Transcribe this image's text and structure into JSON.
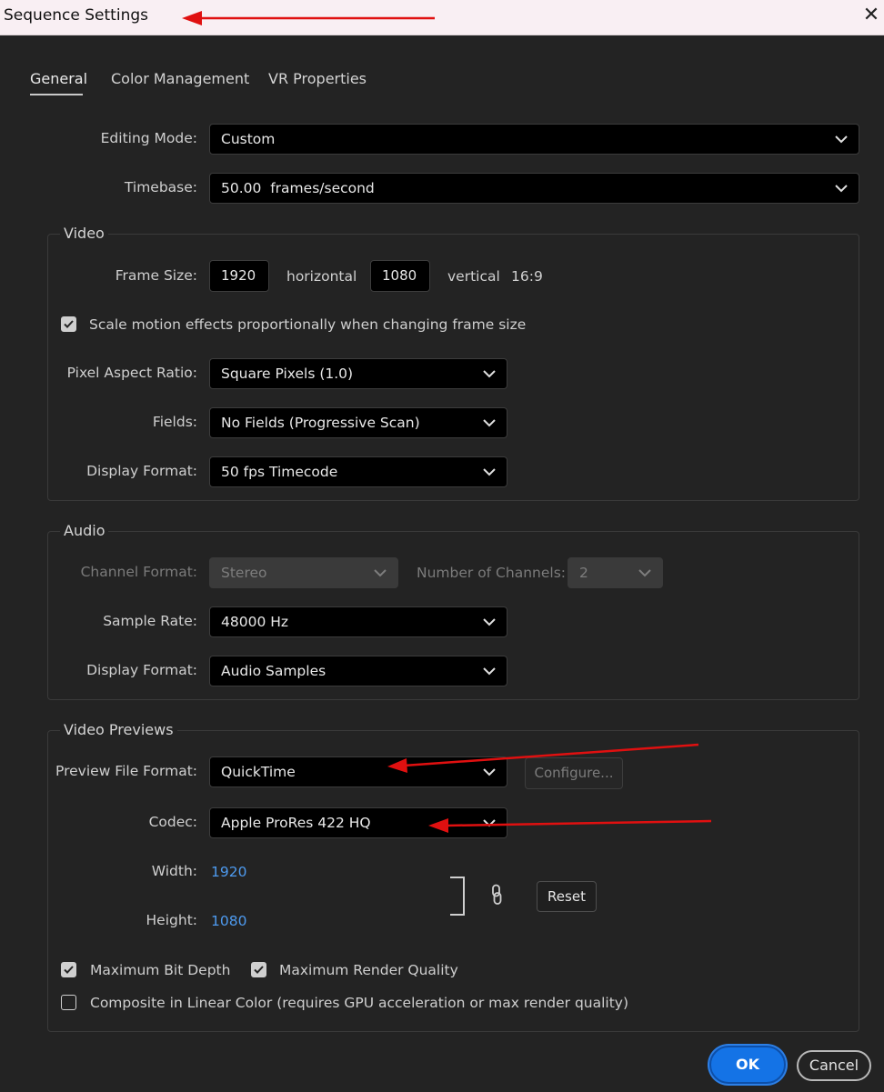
{
  "window": {
    "title": "Sequence Settings",
    "close_glyph": "✕"
  },
  "tabs": [
    {
      "label": "General",
      "active": true
    },
    {
      "label": "Color Management",
      "active": false
    },
    {
      "label": "VR Properties",
      "active": false
    }
  ],
  "general": {
    "editing_mode": {
      "label": "Editing Mode:",
      "value": "Custom"
    },
    "timebase": {
      "label": "Timebase:",
      "value": "50.00  frames/second"
    }
  },
  "video": {
    "title": "Video",
    "frame_size": {
      "label": "Frame Size:",
      "width": "1920",
      "horizontal": "horizontal",
      "height": "1080",
      "vertical": "vertical",
      "aspect": "16:9"
    },
    "scale_motion": {
      "label": "Scale motion effects proportionally when changing frame size",
      "checked": true
    },
    "pixel_aspect": {
      "label": "Pixel Aspect Ratio:",
      "value": "Square Pixels (1.0)"
    },
    "fields": {
      "label": "Fields:",
      "value": "No Fields (Progressive Scan)"
    },
    "display_format": {
      "label": "Display Format:",
      "value": "50 fps Timecode"
    }
  },
  "audio": {
    "title": "Audio",
    "channel_format": {
      "label": "Channel Format:",
      "value": "Stereo"
    },
    "num_channels": {
      "label": "Number of Channels:",
      "value": "2"
    },
    "sample_rate": {
      "label": "Sample Rate:",
      "value": "48000 Hz"
    },
    "display_format": {
      "label": "Display Format:",
      "value": "Audio Samples"
    }
  },
  "previews": {
    "title": "Video Previews",
    "file_format": {
      "label": "Preview File Format:",
      "value": "QuickTime"
    },
    "configure_label": "Configure...",
    "codec": {
      "label": "Codec:",
      "value": "Apple ProRes 422 HQ"
    },
    "width": {
      "label": "Width:",
      "value": "1920"
    },
    "height": {
      "label": "Height:",
      "value": "1080"
    },
    "reset_label": "Reset",
    "max_bit_depth": {
      "label": "Maximum Bit Depth",
      "checked": true
    },
    "max_render_quality": {
      "label": "Maximum Render Quality",
      "checked": true
    },
    "linear_color": {
      "label": "Composite in Linear Color (requires GPU acceleration or max render quality)",
      "checked": false
    }
  },
  "footer": {
    "ok_label": "OK",
    "cancel_label": "Cancel"
  },
  "colors": {
    "accent": "#1473e6",
    "annotation_arrow": "#e01010",
    "link_value": "#4e9bf0"
  },
  "icons": [
    "close-icon",
    "chevron-down-icon",
    "check-icon",
    "link-chain-icon",
    "bracket-icon",
    "arrow-annotation"
  ]
}
